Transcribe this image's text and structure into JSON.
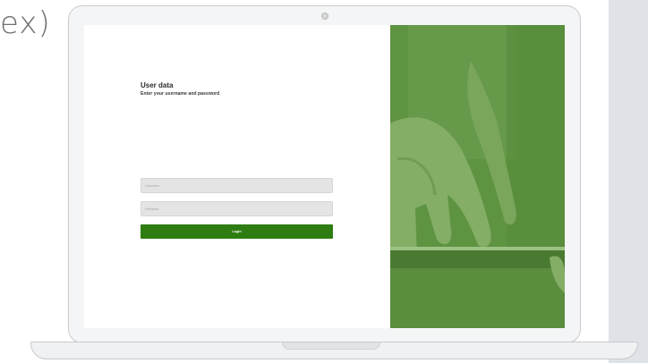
{
  "page": {
    "partial_text": "ex)"
  },
  "login": {
    "title": "User data",
    "subtitle": "Enter your username and password",
    "username_placeholder": "Username",
    "password_placeholder": "Password",
    "button_label": "Login"
  },
  "colors": {
    "accent": "#2e7d12",
    "image_overlay": "#5e9341",
    "field_background": "#e4e4e4"
  },
  "icons": {
    "camera": "camera-icon"
  }
}
